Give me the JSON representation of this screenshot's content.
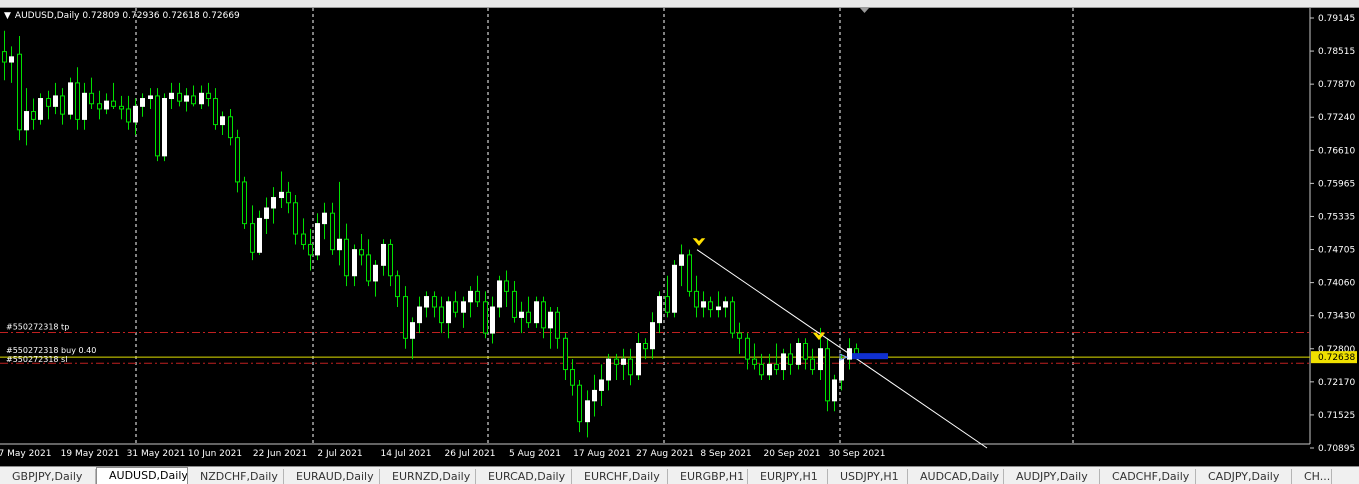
{
  "header": {
    "symbol_line": "AUDUSD,Daily  0.72809 0.72936 0.72618 0.72669"
  },
  "price_axis": {
    "labels": [
      "0.79145",
      "0.78515",
      "0.77870",
      "0.77240",
      "0.76610",
      "0.75965",
      "0.75335",
      "0.74705",
      "0.74060",
      "0.73430",
      "0.72800",
      "0.72170",
      "0.71525",
      "0.70895"
    ],
    "current_price": "0.72638",
    "current_price_color": "#f0e000"
  },
  "time_axis": {
    "labels": [
      "7 May 2021",
      "19 May 2021",
      "31 May 2021",
      "10 Jun 2021",
      "22 Jun 2021",
      "2 Jul 2021",
      "14 Jul 2021",
      "26 Jul 2021",
      "5 Aug 2021",
      "17 Aug 2021",
      "27 Aug 2021",
      "8 Sep 2021",
      "20 Sep 2021",
      "30 Sep 2021"
    ]
  },
  "trade_lines": {
    "tp_label": "#550272318 tp",
    "buy_label": "#550272318 buy 0.40",
    "sl_label": "#550272318 sl"
  },
  "colors": {
    "bull_candle": "#ffffff",
    "wick": "#00e000",
    "bid_line": "#e0e000",
    "tp_sl_line": "#c02020",
    "trendline": "#ffffff",
    "arrow": "#ffe000",
    "entry_box": "#1030d0"
  },
  "chart_data": {
    "type": "candlestick",
    "symbol": "AUDUSD",
    "timeframe": "Daily",
    "ylim": [
      0.70895,
      0.79145
    ],
    "tp_price": 0.7311,
    "buy_price": 0.72638,
    "sl_price": 0.7252,
    "candles": [
      [
        0.785,
        0.789,
        0.7795,
        0.783
      ],
      [
        0.783,
        0.786,
        0.779,
        0.784
      ],
      [
        0.7845,
        0.788,
        0.768,
        0.77
      ],
      [
        0.77,
        0.778,
        0.767,
        0.7735
      ],
      [
        0.7735,
        0.776,
        0.77,
        0.772
      ],
      [
        0.772,
        0.777,
        0.771,
        0.776
      ],
      [
        0.776,
        0.7775,
        0.772,
        0.7745
      ],
      [
        0.7745,
        0.779,
        0.773,
        0.7765
      ],
      [
        0.7765,
        0.778,
        0.771,
        0.773
      ],
      [
        0.773,
        0.78,
        0.772,
        0.779
      ],
      [
        0.779,
        0.782,
        0.77,
        0.772
      ],
      [
        0.772,
        0.779,
        0.77,
        0.777
      ],
      [
        0.777,
        0.78,
        0.774,
        0.775
      ],
      [
        0.775,
        0.7775,
        0.772,
        0.774
      ],
      [
        0.774,
        0.777,
        0.773,
        0.7755
      ],
      [
        0.7755,
        0.779,
        0.774,
        0.7745
      ],
      [
        0.7745,
        0.7765,
        0.772,
        0.774
      ],
      [
        0.774,
        0.7765,
        0.77,
        0.7715
      ],
      [
        0.7715,
        0.776,
        0.769,
        0.7745
      ],
      [
        0.7745,
        0.777,
        0.7725,
        0.776
      ],
      [
        0.776,
        0.778,
        0.774,
        0.7765
      ],
      [
        0.7765,
        0.778,
        0.764,
        0.765
      ],
      [
        0.765,
        0.777,
        0.764,
        0.776
      ],
      [
        0.776,
        0.779,
        0.774,
        0.777
      ],
      [
        0.777,
        0.779,
        0.7745,
        0.7755
      ],
      [
        0.7755,
        0.778,
        0.7735,
        0.7765
      ],
      [
        0.7765,
        0.7785,
        0.7745,
        0.775
      ],
      [
        0.775,
        0.7785,
        0.774,
        0.777
      ],
      [
        0.777,
        0.779,
        0.7745,
        0.776
      ],
      [
        0.776,
        0.778,
        0.77,
        0.771
      ],
      [
        0.771,
        0.7735,
        0.769,
        0.7725
      ],
      [
        0.7725,
        0.774,
        0.767,
        0.7685
      ],
      [
        0.7685,
        0.77,
        0.758,
        0.76
      ],
      [
        0.76,
        0.761,
        0.751,
        0.752
      ],
      [
        0.752,
        0.7555,
        0.745,
        0.7465
      ],
      [
        0.7465,
        0.7545,
        0.746,
        0.753
      ],
      [
        0.753,
        0.757,
        0.75,
        0.755
      ],
      [
        0.755,
        0.759,
        0.752,
        0.757
      ],
      [
        0.757,
        0.762,
        0.755,
        0.758
      ],
      [
        0.758,
        0.76,
        0.754,
        0.756
      ],
      [
        0.756,
        0.7575,
        0.748,
        0.75
      ],
      [
        0.75,
        0.753,
        0.747,
        0.748
      ],
      [
        0.748,
        0.751,
        0.743,
        0.746
      ],
      [
        0.746,
        0.754,
        0.745,
        0.752
      ],
      [
        0.752,
        0.756,
        0.749,
        0.754
      ],
      [
        0.754,
        0.756,
        0.746,
        0.747
      ],
      [
        0.747,
        0.76,
        0.744,
        0.749
      ],
      [
        0.749,
        0.752,
        0.74,
        0.742
      ],
      [
        0.742,
        0.748,
        0.74,
        0.747
      ],
      [
        0.747,
        0.75,
        0.744,
        0.746
      ],
      [
        0.746,
        0.749,
        0.74,
        0.741
      ],
      [
        0.741,
        0.745,
        0.738,
        0.744
      ],
      [
        0.744,
        0.749,
        0.742,
        0.748
      ],
      [
        0.748,
        0.749,
        0.74,
        0.742
      ],
      [
        0.742,
        0.743,
        0.736,
        0.738
      ],
      [
        0.738,
        0.74,
        0.728,
        0.73
      ],
      [
        0.73,
        0.734,
        0.726,
        0.733
      ],
      [
        0.733,
        0.738,
        0.731,
        0.736
      ],
      [
        0.736,
        0.739,
        0.734,
        0.738
      ],
      [
        0.738,
        0.739,
        0.734,
        0.736
      ],
      [
        0.736,
        0.738,
        0.731,
        0.733
      ],
      [
        0.733,
        0.738,
        0.73,
        0.737
      ],
      [
        0.737,
        0.739,
        0.734,
        0.735
      ],
      [
        0.735,
        0.738,
        0.732,
        0.737
      ],
      [
        0.737,
        0.74,
        0.734,
        0.739
      ],
      [
        0.739,
        0.742,
        0.736,
        0.737
      ],
      [
        0.737,
        0.739,
        0.73,
        0.731
      ],
      [
        0.731,
        0.738,
        0.729,
        0.736
      ],
      [
        0.736,
        0.742,
        0.734,
        0.741
      ],
      [
        0.741,
        0.743,
        0.736,
        0.739
      ],
      [
        0.739,
        0.741,
        0.733,
        0.734
      ],
      [
        0.734,
        0.737,
        0.731,
        0.735
      ],
      [
        0.735,
        0.738,
        0.732,
        0.733
      ],
      [
        0.733,
        0.738,
        0.732,
        0.737
      ],
      [
        0.737,
        0.738,
        0.73,
        0.732
      ],
      [
        0.732,
        0.736,
        0.728,
        0.735
      ],
      [
        0.735,
        0.736,
        0.728,
        0.73
      ],
      [
        0.73,
        0.731,
        0.722,
        0.724
      ],
      [
        0.724,
        0.726,
        0.719,
        0.721
      ],
      [
        0.721,
        0.722,
        0.712,
        0.714
      ],
      [
        0.714,
        0.72,
        0.711,
        0.718
      ],
      [
        0.718,
        0.723,
        0.715,
        0.72
      ],
      [
        0.72,
        0.725,
        0.717,
        0.722
      ],
      [
        0.722,
        0.727,
        0.72,
        0.726
      ],
      [
        0.726,
        0.727,
        0.722,
        0.725
      ],
      [
        0.725,
        0.728,
        0.722,
        0.726
      ],
      [
        0.726,
        0.728,
        0.721,
        0.723
      ],
      [
        0.723,
        0.731,
        0.722,
        0.729
      ],
      [
        0.729,
        0.73,
        0.726,
        0.728
      ],
      [
        0.728,
        0.735,
        0.726,
        0.733
      ],
      [
        0.733,
        0.739,
        0.731,
        0.738
      ],
      [
        0.738,
        0.742,
        0.734,
        0.735
      ],
      [
        0.735,
        0.745,
        0.734,
        0.744
      ],
      [
        0.744,
        0.748,
        0.74,
        0.746
      ],
      [
        0.746,
        0.747,
        0.738,
        0.739
      ],
      [
        0.739,
        0.742,
        0.734,
        0.736
      ],
      [
        0.736,
        0.739,
        0.734,
        0.737
      ],
      [
        0.737,
        0.738,
        0.734,
        0.7355
      ],
      [
        0.7355,
        0.739,
        0.734,
        0.736
      ],
      [
        0.736,
        0.738,
        0.734,
        0.737
      ],
      [
        0.737,
        0.738,
        0.73,
        0.731
      ],
      [
        0.731,
        0.733,
        0.727,
        0.73
      ],
      [
        0.73,
        0.731,
        0.724,
        0.726
      ],
      [
        0.726,
        0.729,
        0.724,
        0.725
      ],
      [
        0.725,
        0.727,
        0.722,
        0.723
      ],
      [
        0.723,
        0.727,
        0.722,
        0.725
      ],
      [
        0.725,
        0.729,
        0.723,
        0.724
      ],
      [
        0.724,
        0.728,
        0.722,
        0.727
      ],
      [
        0.727,
        0.729,
        0.723,
        0.725
      ],
      [
        0.725,
        0.73,
        0.724,
        0.729
      ],
      [
        0.729,
        0.73,
        0.724,
        0.726
      ],
      [
        0.726,
        0.728,
        0.723,
        0.724
      ],
      [
        0.724,
        0.732,
        0.722,
        0.728
      ],
      [
        0.728,
        0.73,
        0.716,
        0.718
      ],
      [
        0.718,
        0.723,
        0.716,
        0.722
      ],
      [
        0.722,
        0.727,
        0.72,
        0.726
      ],
      [
        0.726,
        0.73,
        0.724,
        0.728
      ],
      [
        0.728,
        0.729,
        0.726,
        0.7267
      ]
    ],
    "trendline": {
      "from": [
        "3 Sep 2021",
        0.747
      ],
      "to": [
        "after 30 Sep 2021",
        0.709
      ]
    },
    "markers": [
      {
        "type": "down-arrow",
        "price": 0.7483
      },
      {
        "type": "down-arrow",
        "price": 0.7302
      }
    ]
  },
  "tabs": [
    "GBPJPY,Daily",
    "AUDUSD,Daily",
    "NZDCHF,Daily",
    "EURAUD,Daily",
    "EURNZD,Daily",
    "EURCAD,Daily",
    "EURCHF,Daily",
    "EURGBP,H1",
    "EURJPY,H1",
    "USDJPY,H1",
    "AUDCAD,Daily",
    "AUDJPY,Daily",
    "CADCHF,Daily",
    "CADJPY,Daily",
    "CH..."
  ],
  "active_tab": 1
}
